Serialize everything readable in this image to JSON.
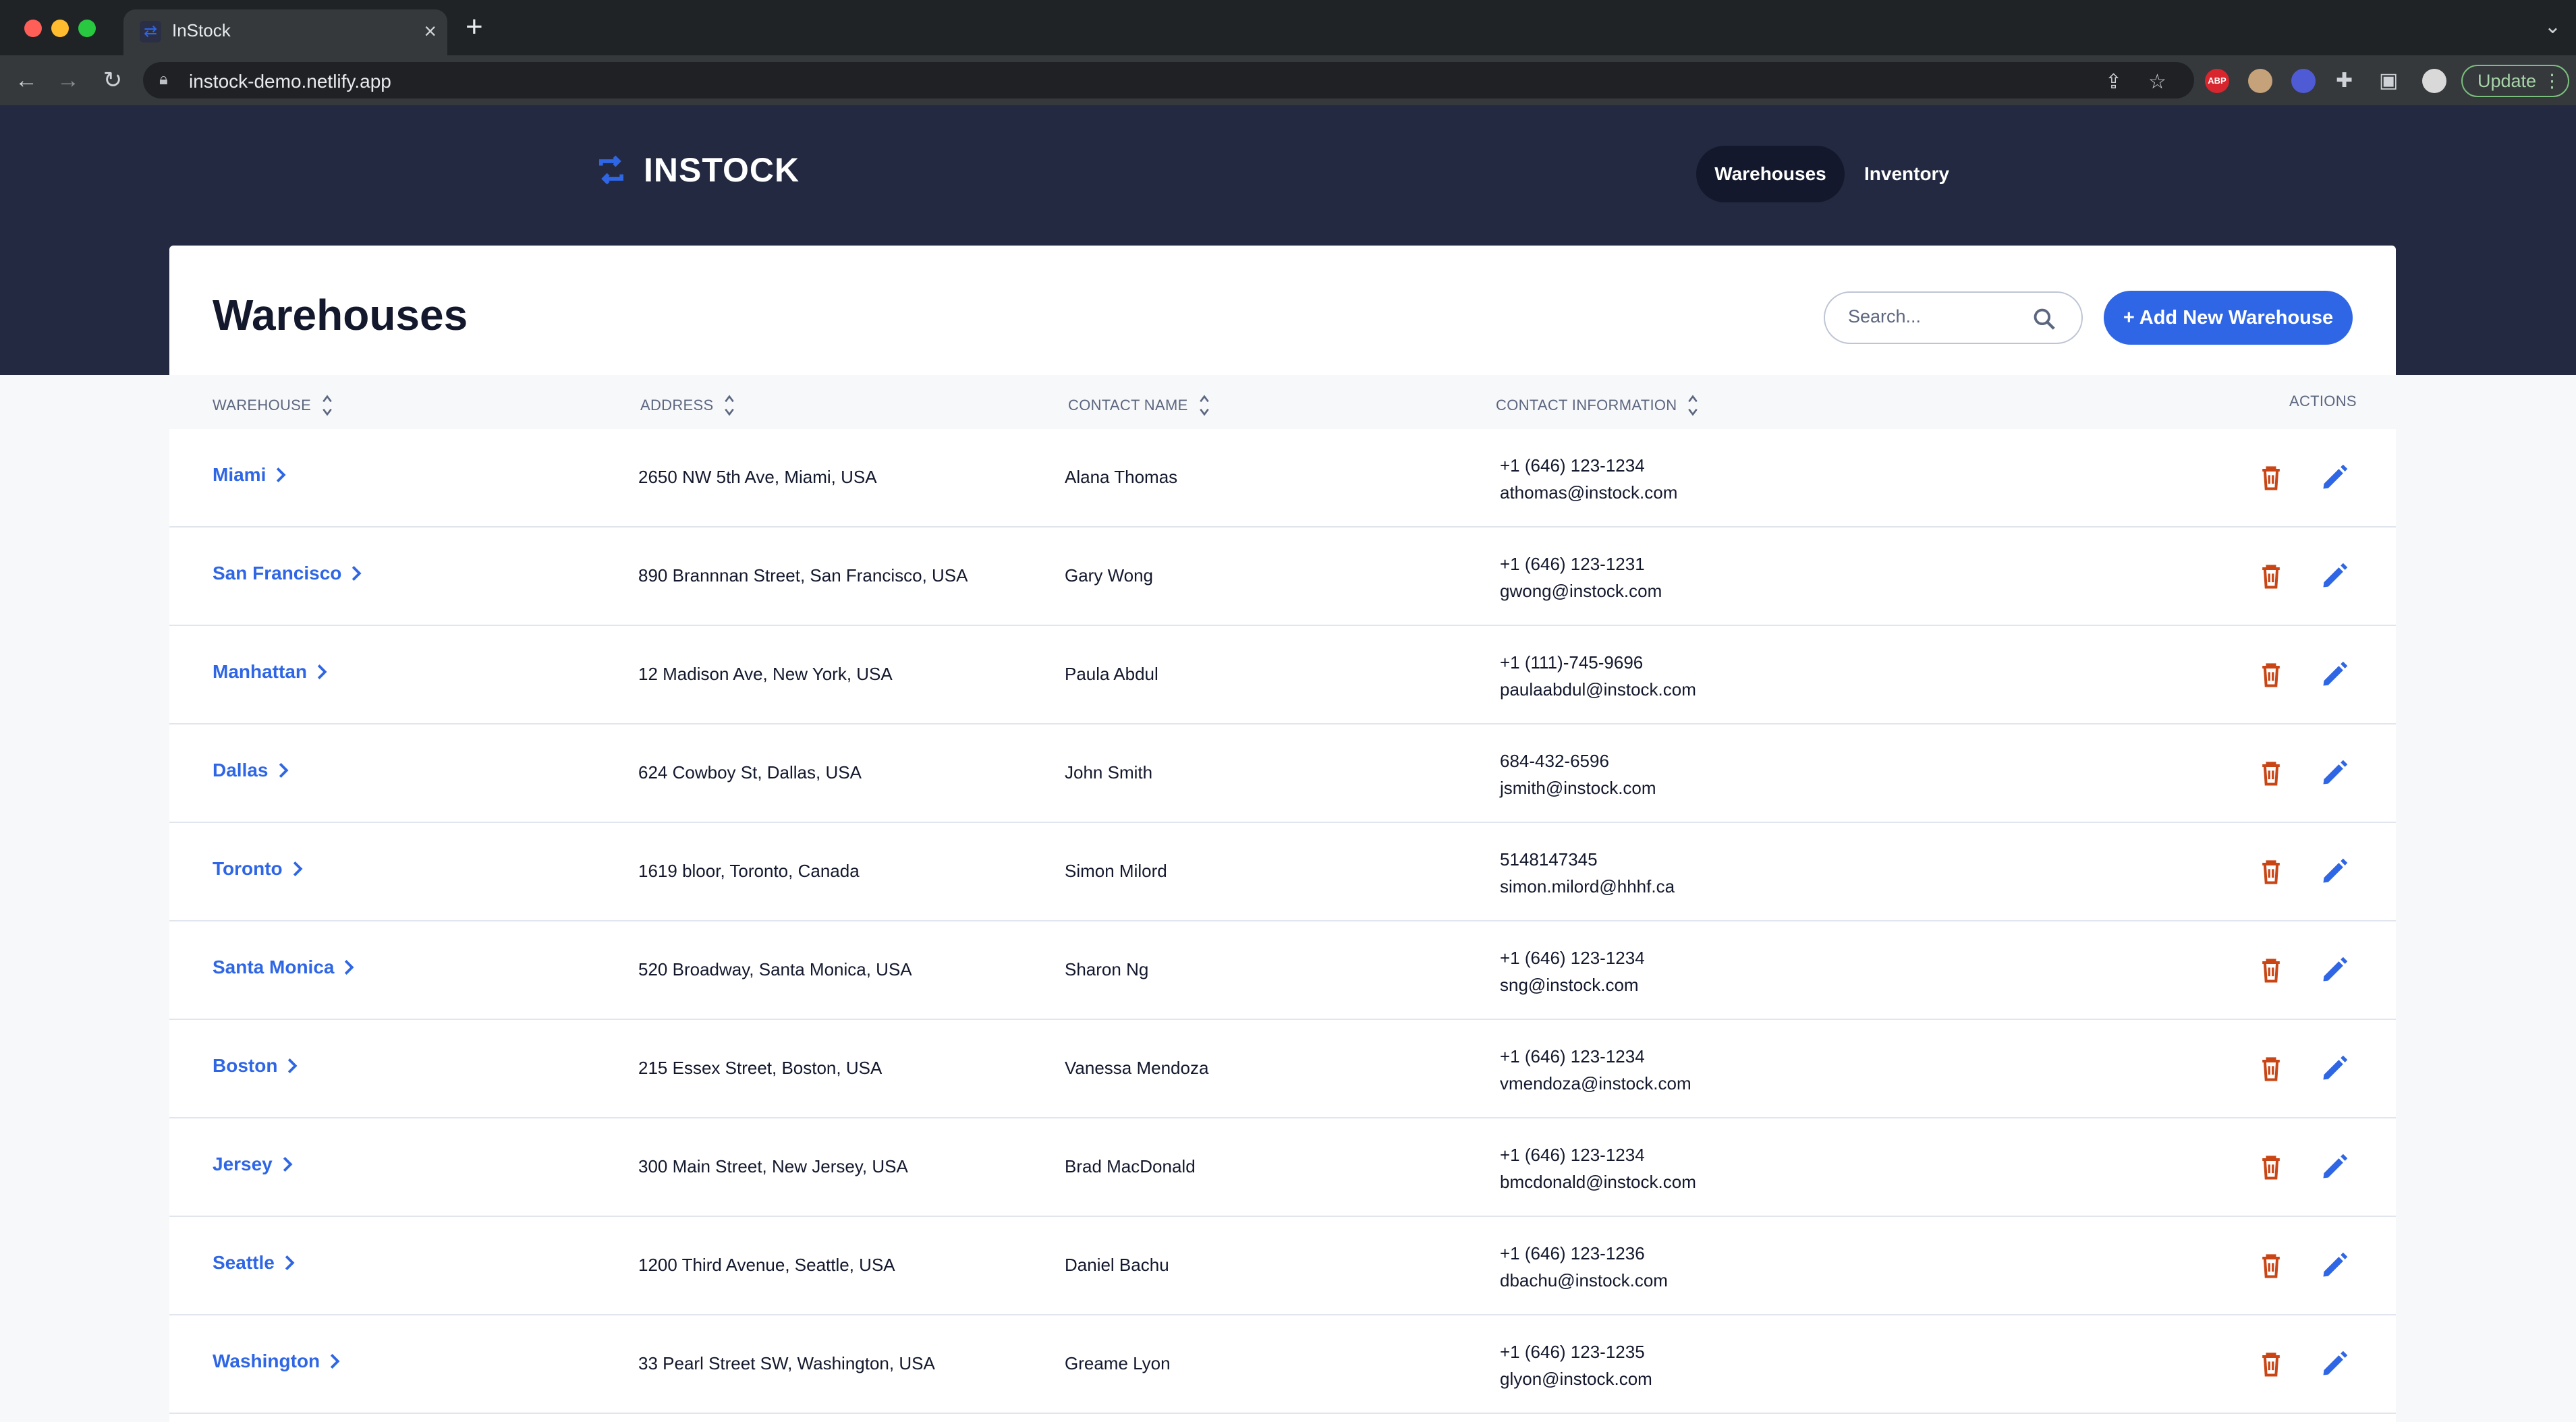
{
  "browser": {
    "tab_title": "InStock",
    "url": "instock-demo.netlify.app",
    "update_label": "Update",
    "ext_abp": "ABP"
  },
  "app": {
    "logo_text": "INSTOCK",
    "nav": {
      "warehouses": "Warehouses",
      "inventory": "Inventory"
    },
    "brand_color": "#2e66e5",
    "header_color": "#232940",
    "delete_color": "#c94515"
  },
  "page": {
    "title": "Warehouses",
    "search_placeholder": "Search...",
    "add_button": "+ Add New Warehouse"
  },
  "table": {
    "headers": {
      "warehouse": "WAREHOUSE",
      "address": "ADDRESS",
      "contact_name": "CONTACT NAME",
      "contact_info": "CONTACT INFORMATION",
      "actions": "ACTIONS"
    },
    "rows": [
      {
        "warehouse": "Miami",
        "address": "2650 NW 5th Ave, Miami, USA",
        "contact": "Alana Thomas",
        "phone": "+1 (646) 123-1234",
        "email": "athomas@instock.com"
      },
      {
        "warehouse": "San Francisco",
        "address": "890 Brannnan Street, San Francisco, USA",
        "contact": "Gary Wong",
        "phone": "+1 (646) 123-1231",
        "email": "gwong@instock.com"
      },
      {
        "warehouse": "Manhattan",
        "address": "12 Madison Ave, New York, USA",
        "contact": "Paula Abdul",
        "phone": "+1 (111)-745-9696",
        "email": "paulaabdul@instock.com"
      },
      {
        "warehouse": "Dallas",
        "address": "624 Cowboy St, Dallas, USA",
        "contact": "John Smith",
        "phone": "684-432-6596",
        "email": "jsmith@instock.com"
      },
      {
        "warehouse": "Toronto",
        "address": "1619 bloor, Toronto, Canada",
        "contact": "Simon Milord",
        "phone": "5148147345",
        "email": "simon.milord@hhhf.ca"
      },
      {
        "warehouse": "Santa Monica",
        "address": "520 Broadway, Santa Monica, USA",
        "contact": "Sharon Ng",
        "phone": "+1 (646) 123-1234",
        "email": "sng@instock.com"
      },
      {
        "warehouse": "Boston",
        "address": "215 Essex Street, Boston, USA",
        "contact": "Vanessa Mendoza",
        "phone": "+1 (646) 123-1234",
        "email": "vmendoza@instock.com"
      },
      {
        "warehouse": "Jersey",
        "address": "300 Main Street, New Jersey, USA",
        "contact": "Brad MacDonald",
        "phone": "+1 (646) 123-1234",
        "email": "bmcdonald@instock.com"
      },
      {
        "warehouse": "Seattle",
        "address": "1200 Third Avenue, Seattle, USA",
        "contact": "Daniel Bachu",
        "phone": "+1 (646) 123-1236",
        "email": "dbachu@instock.com"
      },
      {
        "warehouse": "Washington",
        "address": "33 Pearl Street SW, Washington, USA",
        "contact": "Greame Lyon",
        "phone": "+1 (646) 123-1235",
        "email": "glyon@instock.com"
      }
    ]
  }
}
